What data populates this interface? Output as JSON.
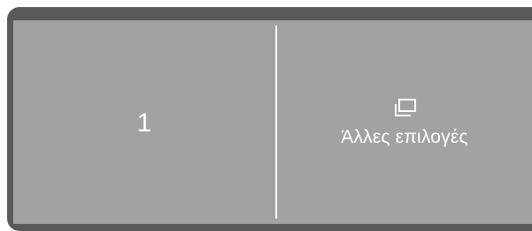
{
  "panel": {
    "left_tile": {
      "value": "1"
    },
    "right_tile": {
      "icon": "windows-stack-icon",
      "label": "Άλλες επιλογές"
    }
  },
  "colors": {
    "frame": "#58595b",
    "screen": "#a1a2a4",
    "text": "#ffffff"
  }
}
